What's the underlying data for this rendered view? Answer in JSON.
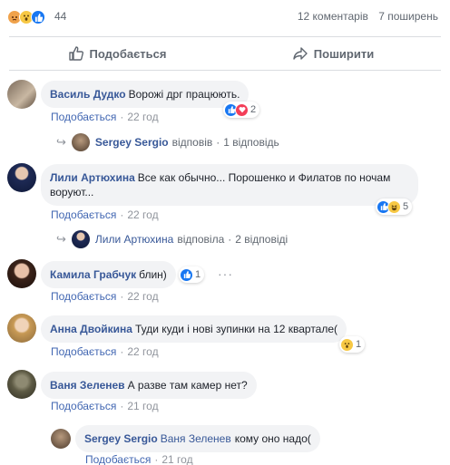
{
  "stats": {
    "reaction_icons": [
      "angry-icon",
      "wow-icon",
      "like-icon"
    ],
    "reaction_count": "44",
    "comments": "12 коментарів",
    "shares": "7 поширень"
  },
  "actions": {
    "like_label": "Подобається",
    "share_label": "Поширити"
  },
  "meta": {
    "like_label": "Подобається",
    "separator": "·"
  },
  "comments": [
    {
      "author": "Василь Дудко",
      "text": "Ворожі дрг працюють.",
      "time": "22 год",
      "reactions": [
        "like-icon",
        "love-icon"
      ],
      "reaction_count": "2",
      "reply": {
        "name": "Sergey Sergio",
        "verb": "відповів",
        "count": "1 відповідь"
      }
    },
    {
      "author": "Лили Артюхина",
      "text": "Все как обычно... Порошенко и Филатов по ночам воруют...",
      "time": "22 год",
      "reactions": [
        "like-icon",
        "haha-icon"
      ],
      "reaction_count": "5",
      "reply": {
        "name": "Лили Артюхина",
        "verb": "відповіла",
        "count": "2 відповіді"
      }
    },
    {
      "author": "Камила Грабчук",
      "text": "блин)",
      "time": "22 год",
      "reactions": [
        "like-icon"
      ],
      "reaction_count": "1",
      "more": "···"
    },
    {
      "author": "Анна Двойкина",
      "text": "Туди куди і нові зупинки на 12 квартале(",
      "time": "22 год",
      "reactions": [
        "wow-icon"
      ],
      "reaction_count": "1"
    },
    {
      "author": "Ваня Зеленев",
      "text": "А разве там камер нет?",
      "time": "21 год"
    }
  ],
  "nested_reply": {
    "author": "Sergey Sergio",
    "mention": "Ваня Зеленев",
    "text": "кому оно надо(",
    "time": "21 год"
  },
  "colors": {
    "link": "#385898",
    "like_blue": "#1877f2",
    "bubble": "#f2f3f5",
    "meta": "#90949c"
  }
}
